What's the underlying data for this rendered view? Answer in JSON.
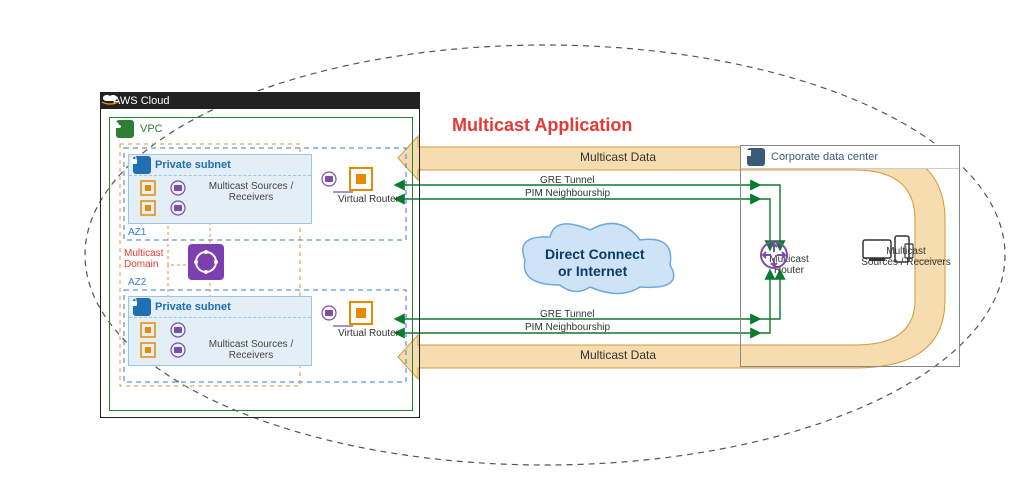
{
  "title": "Multicast Application",
  "aws": {
    "cloud_label": "AWS Cloud",
    "vpc_label": "VPC",
    "az1_label": "AZ1",
    "az2_label": "AZ2",
    "subnet_label": "Private subnet",
    "multicast_group_label": "Multicast\nSources / Receivers",
    "virtual_router_label": "Virtual Router",
    "tgw_label": "TGW",
    "multicast_domain_label": "Multicast\nDomain"
  },
  "center_cloud": {
    "line1": "Direct Connect",
    "line2": "or Internet"
  },
  "corp": {
    "header": "Corporate data center",
    "router_label": "Multicast Router",
    "endpoints_label": "Multicast\nSources / Receivers"
  },
  "links": {
    "gre_label": "GRE Tunnel",
    "pim_label": "PIM Neighbourship",
    "multicast_data_label": "Multicast Data"
  },
  "colors": {
    "title": "#e53935",
    "arrow_band": "#f6dcae",
    "arrow_band_stroke": "#d19a3b",
    "tunnel": "#0a7a2f",
    "vpc": "#2e7d32",
    "tgw": "#6a1b9a",
    "subnet_blue": "#1f6fb2",
    "az_dash": "#3a7bd5",
    "domain_dash": "#d19a3b",
    "cloud_fill": "#cfe3f7",
    "cloud_stroke": "#6fa8dc"
  }
}
